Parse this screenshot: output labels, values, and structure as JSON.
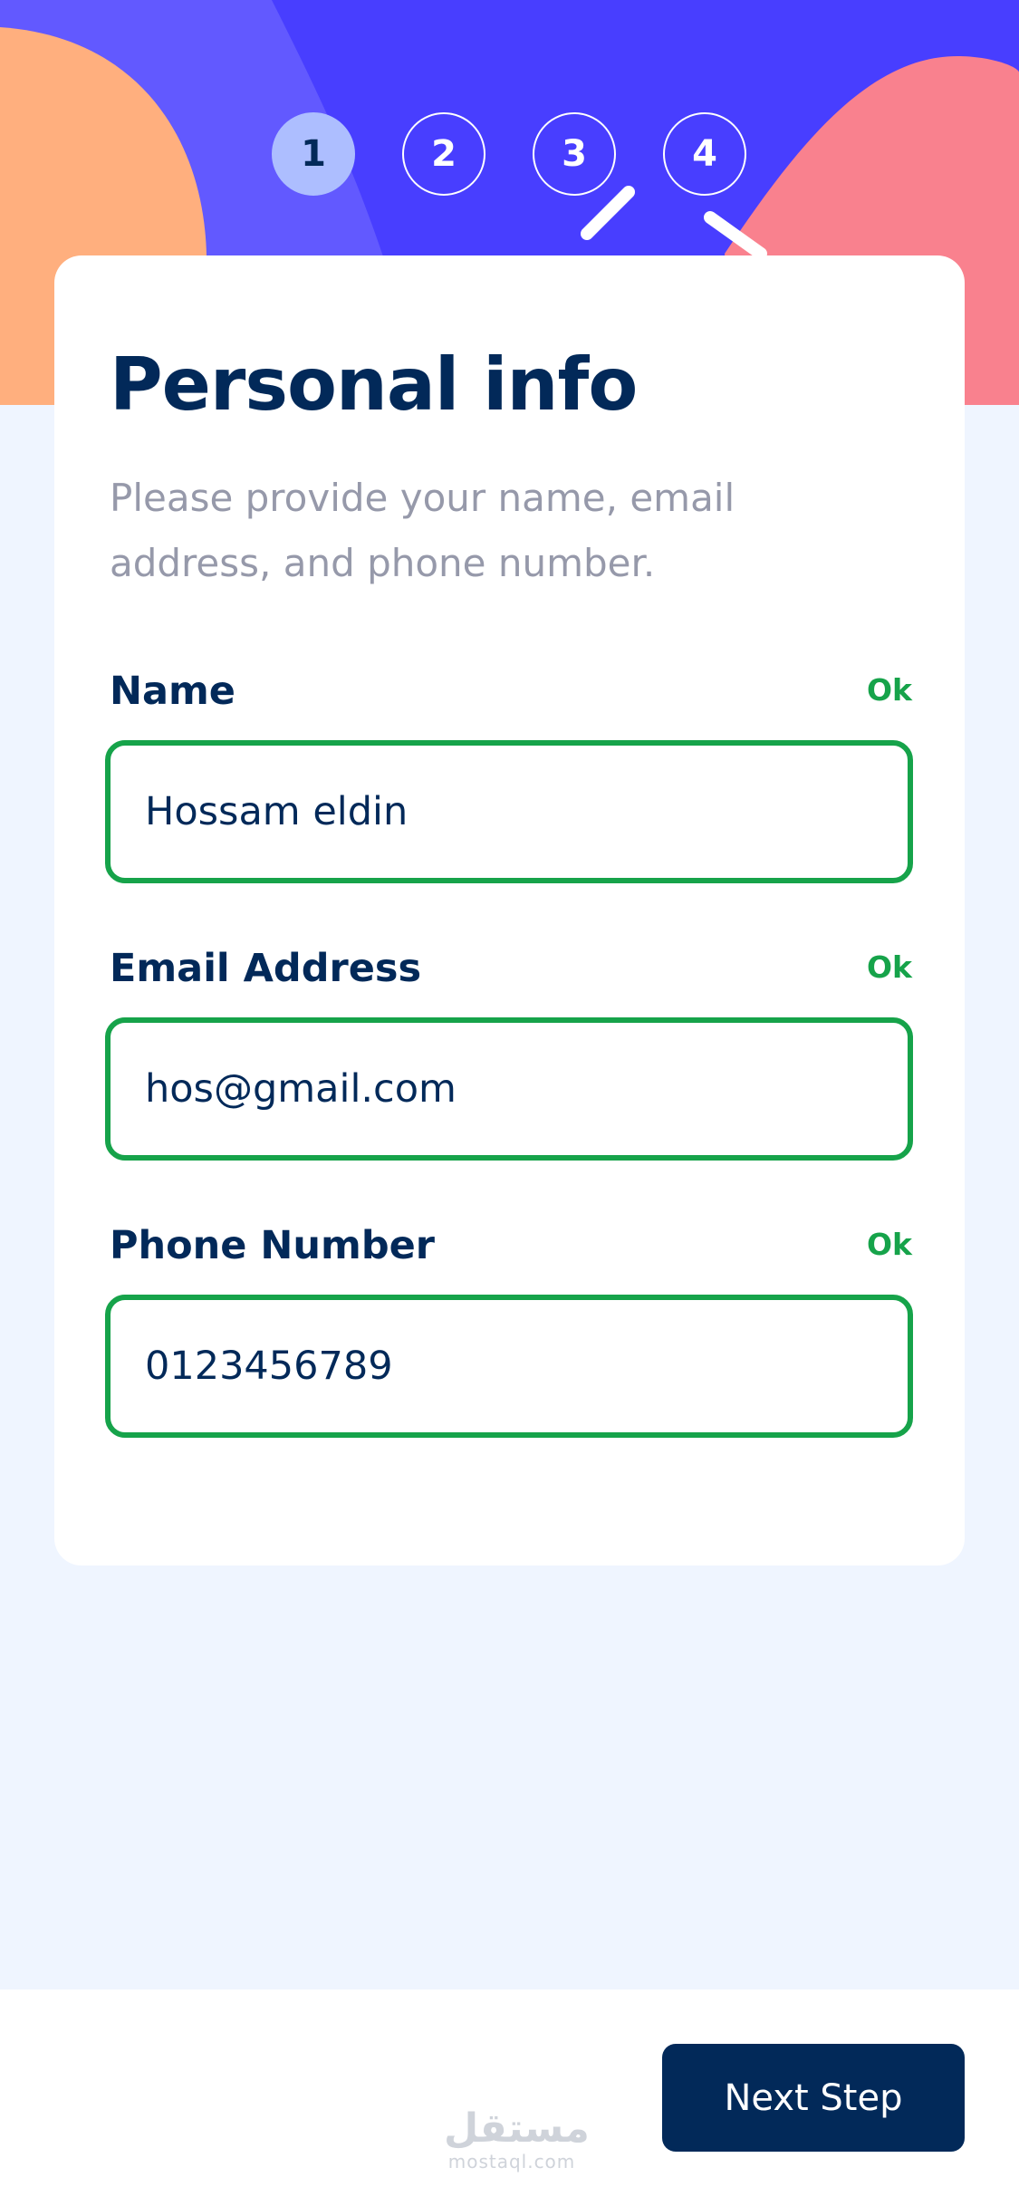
{
  "theme": {
    "primary": "#022959",
    "header_bg": "#483eff",
    "active_step": "#adbeff",
    "success": "#16a34a",
    "page_bg": "#eff5ff",
    "muted_text": "#9699aa"
  },
  "steps": [
    {
      "number": "1",
      "active": true
    },
    {
      "number": "2",
      "active": false
    },
    {
      "number": "3",
      "active": false
    },
    {
      "number": "4",
      "active": false
    }
  ],
  "form": {
    "title": "Personal info",
    "subtitle": "Please provide your name, email address, and phone number.",
    "fields": {
      "name": {
        "label": "Name",
        "value": "Hossam eldin",
        "status": "Ok"
      },
      "email": {
        "label": "Email Address",
        "value": "hos@gmail.com",
        "status": "Ok"
      },
      "phone": {
        "label": "Phone Number",
        "value": "0123456789",
        "status": "Ok"
      }
    }
  },
  "footer": {
    "next_label": "Next Step"
  },
  "watermark": {
    "arabic": "مستقل",
    "latin": "mostaql.com"
  }
}
